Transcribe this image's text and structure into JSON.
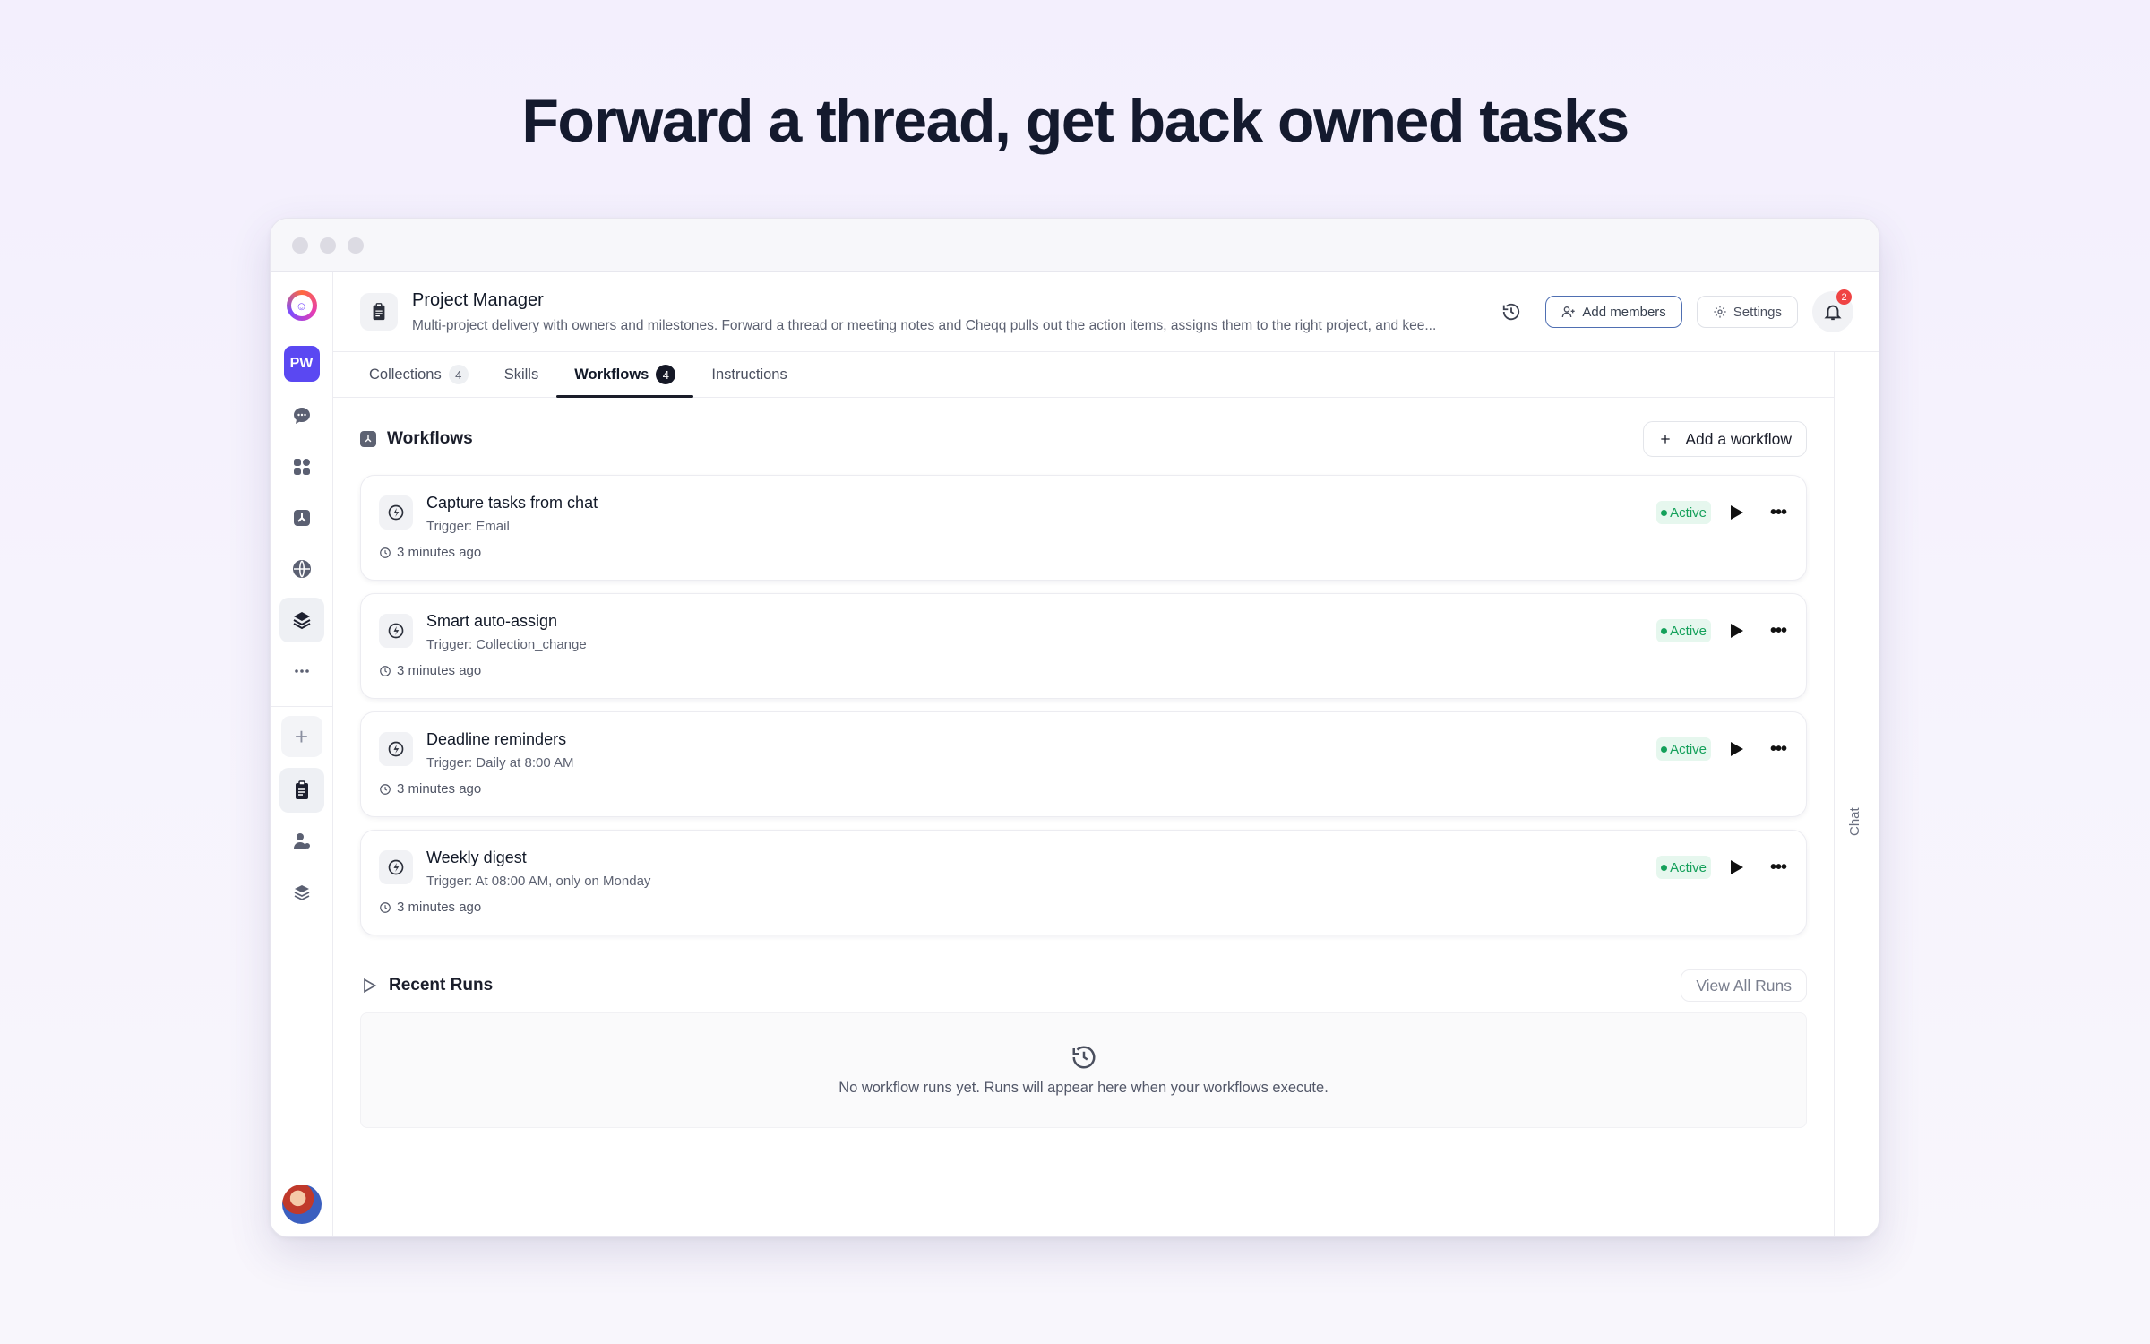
{
  "hero": {
    "title": "Forward a thread, get back owned tasks"
  },
  "sidebar": {
    "workspace_initials": "PW",
    "items": [
      {
        "name": "chat-icon"
      },
      {
        "name": "apps-grid-icon"
      },
      {
        "name": "workflows-icon"
      },
      {
        "name": "globe-icon"
      },
      {
        "name": "layers-icon",
        "active": true
      },
      {
        "name": "more-icon"
      }
    ],
    "add_label": "+"
  },
  "header": {
    "title": "Project Manager",
    "description": "Multi-project delivery with owners and milestones. Forward a thread or meeting notes and Cheqq pulls out the action items, assigns them to the right project, and kee...",
    "add_members_label": "Add members",
    "settings_label": "Settings",
    "notification_count": "2"
  },
  "tabs": [
    {
      "label": "Collections",
      "count": "4"
    },
    {
      "label": "Skills",
      "count": ""
    },
    {
      "label": "Workflows",
      "count": "4",
      "active": true
    },
    {
      "label": "Instructions",
      "count": ""
    }
  ],
  "workflows": {
    "section_title": "Workflows",
    "add_label": "Add a workflow",
    "items": [
      {
        "name": "Capture tasks from chat",
        "trigger": "Trigger: Email",
        "time": "3 minutes ago",
        "status": "Active"
      },
      {
        "name": "Smart auto-assign",
        "trigger": "Trigger: Collection_change",
        "time": "3 minutes ago",
        "status": "Active"
      },
      {
        "name": "Deadline reminders",
        "trigger": "Trigger: Daily at 8:00 AM",
        "time": "3 minutes ago",
        "status": "Active"
      },
      {
        "name": "Weekly digest",
        "trigger": "Trigger: At 08:00 AM, only on Monday",
        "time": "3 minutes ago",
        "status": "Active"
      }
    ]
  },
  "runs": {
    "section_title": "Recent Runs",
    "view_all_label": "View All Runs",
    "empty_text": "No workflow runs yet. Runs will appear here when your workflows execute."
  },
  "chat_rail": {
    "label": "Chat"
  },
  "colors": {
    "accent": "#5a48f2",
    "active_green": "#14a05a",
    "badge_red": "#ef4444"
  }
}
